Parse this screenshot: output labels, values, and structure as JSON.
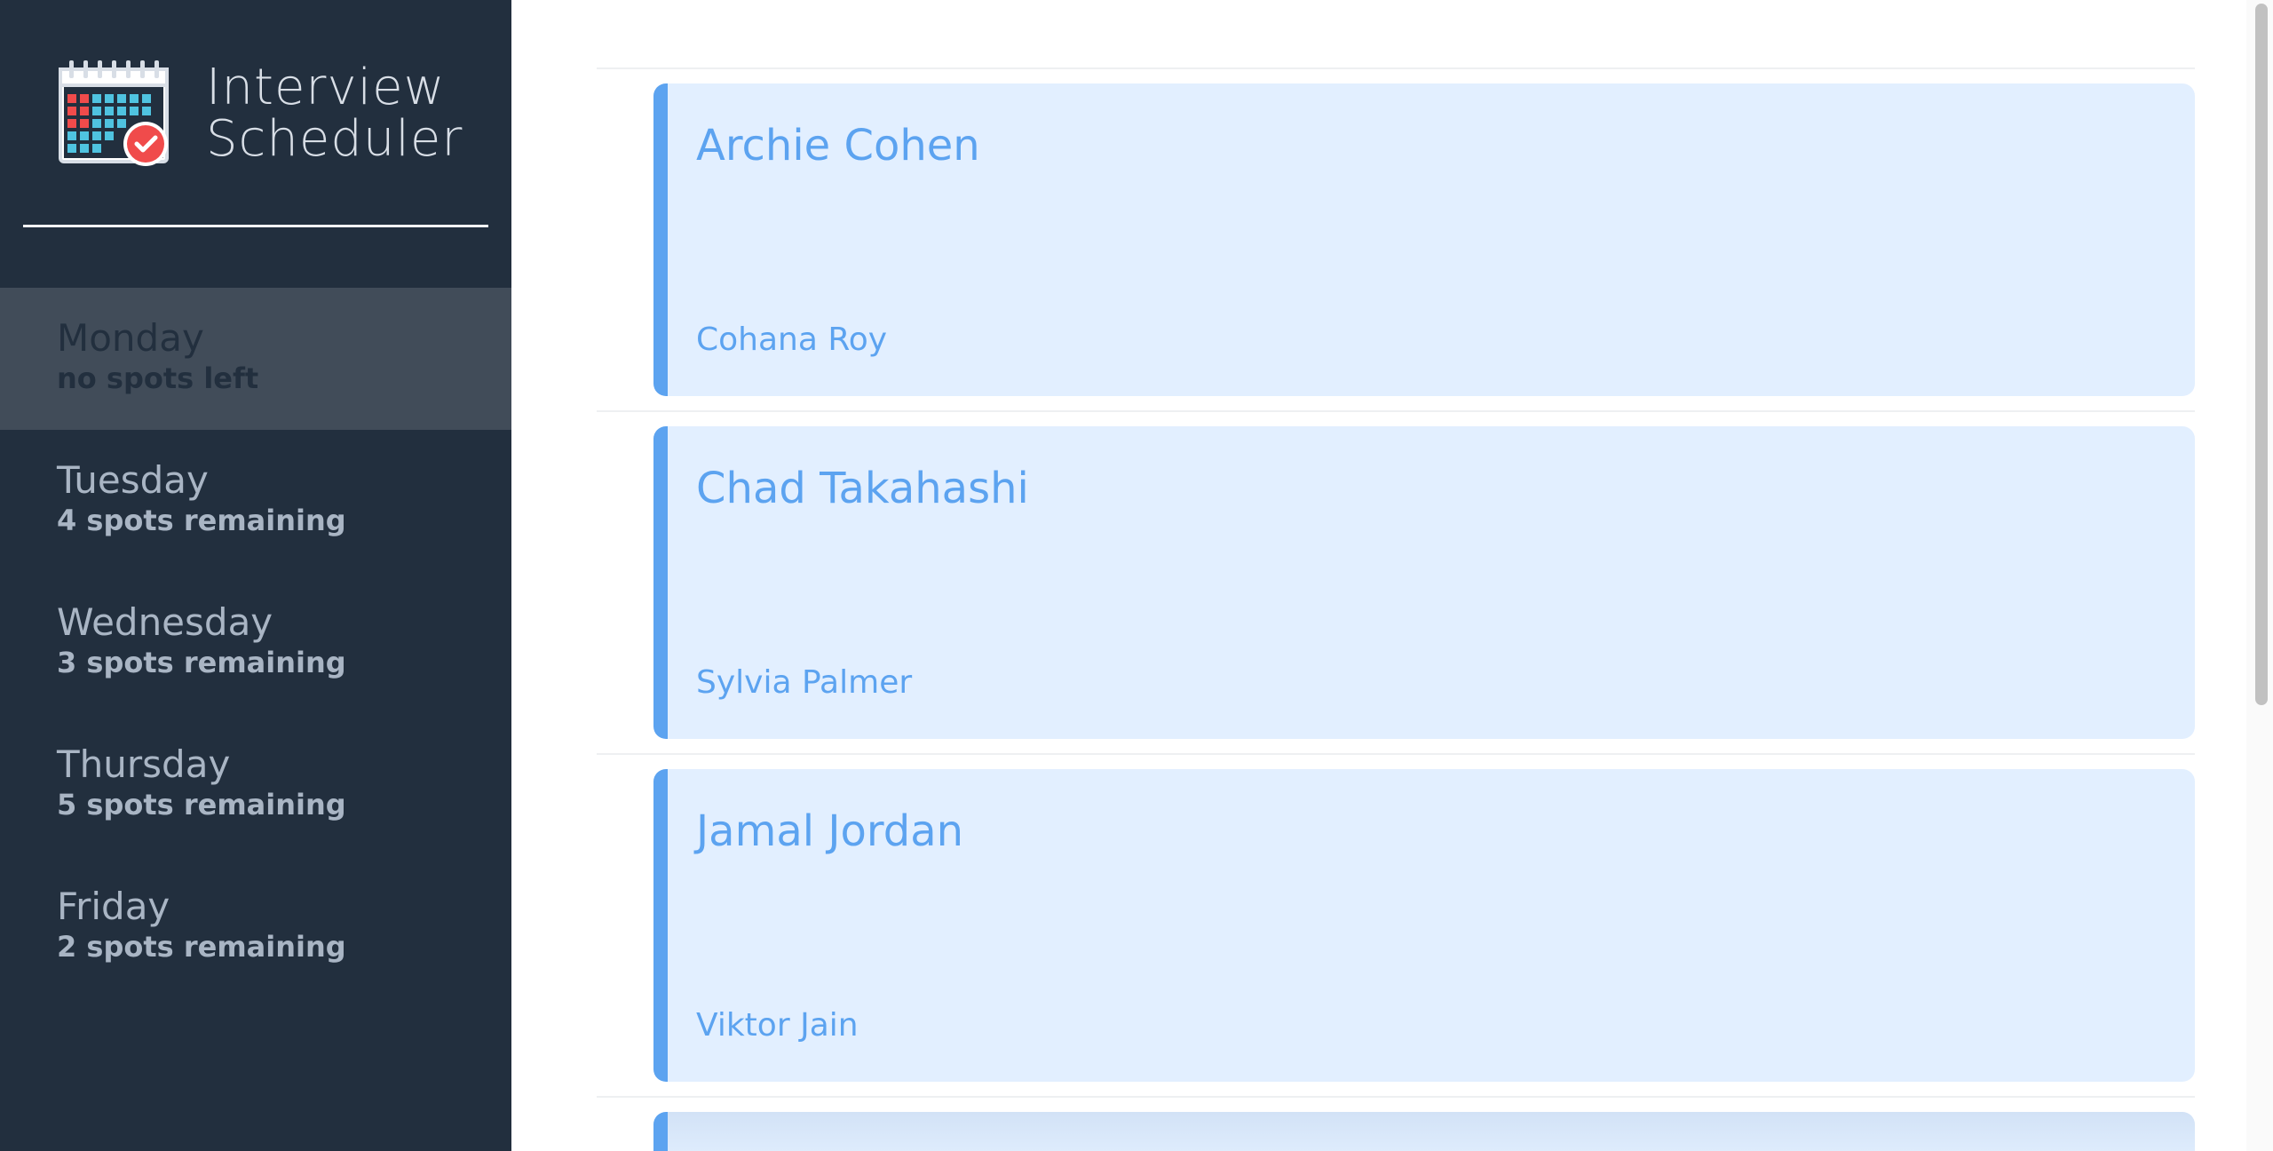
{
  "app": {
    "title_line1": "Interview",
    "title_line2": "Scheduler",
    "logo_icon": "calendar-check-icon",
    "colors": {
      "sidebar_bg": "#222f3e",
      "selected_bg": "#414c59",
      "accent": "#5ca3f0",
      "card_bg": "#e2efff",
      "check_red": "#f04b4b"
    }
  },
  "days": [
    {
      "name": "Monday",
      "spots": "no spots left",
      "selected": true
    },
    {
      "name": "Tuesday",
      "spots": "4 spots remaining",
      "selected": false
    },
    {
      "name": "Wednesday",
      "spots": "3 spots remaining",
      "selected": false
    },
    {
      "name": "Thursday",
      "spots": "5 spots remaining",
      "selected": false
    },
    {
      "name": "Friday",
      "spots": "2 spots remaining",
      "selected": false
    }
  ],
  "appointments": [
    {
      "student": "Archie Cohen",
      "interviewer": "Cohana Roy"
    },
    {
      "student": "Chad Takahashi",
      "interviewer": "Sylvia Palmer"
    },
    {
      "student": "Jamal Jordan",
      "interviewer": "Viktor Jain"
    }
  ]
}
